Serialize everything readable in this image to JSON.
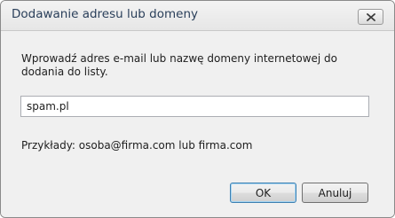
{
  "window": {
    "title": "Dodawanie adresu lub domeny"
  },
  "dialog": {
    "instructions": "Wprowadź adres e-mail lub nazwę domeny internetowej do dodania do listy.",
    "input_value": "spam.pl",
    "examples": "Przykłady: osoba@firma.com lub firma.com"
  },
  "buttons": {
    "ok_label": "OK",
    "cancel_label": "Anuluj"
  },
  "icons": {
    "close": "close-icon"
  },
  "colors": {
    "title_text": "#2a3f5a",
    "default_button_border": "#3c7fb1",
    "dialog_background": "#f0f0f0"
  }
}
